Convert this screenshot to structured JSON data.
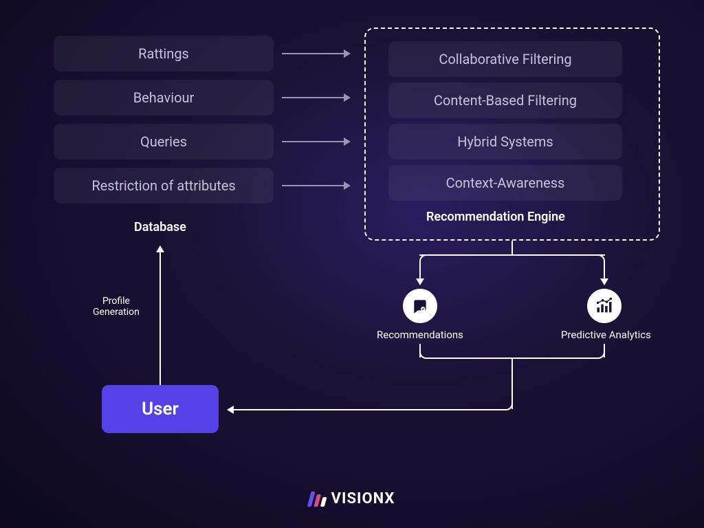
{
  "database": {
    "label": "Database",
    "items": [
      "Rattings",
      "Behaviour",
      "Queries",
      "Restriction of attributes"
    ]
  },
  "engine": {
    "label": "Recommendation Engine",
    "items": [
      "Collaborative Filtering",
      "Content-Based Filtering",
      "Hybrid Systems",
      "Context-Awareness"
    ]
  },
  "profile_label": "Profile\nGeneration",
  "user_label": "User",
  "recommendations_label": "Recommendations",
  "predictive_label": "Predictive Analytics",
  "brand": "VISIONX"
}
